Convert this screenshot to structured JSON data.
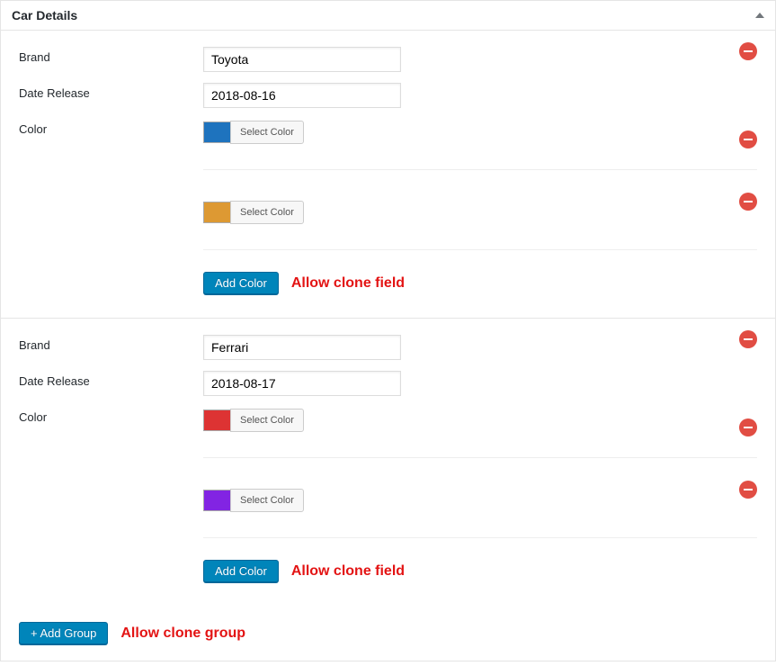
{
  "metabox": {
    "title": "Car Details"
  },
  "labels": {
    "brand": "Brand",
    "date_release": "Date Release",
    "color": "Color",
    "select_color": "Select Color",
    "add_color": "Add Color",
    "add_group": "+ Add Group"
  },
  "annotations": {
    "clone_field": "Allow clone field",
    "clone_group": "Allow clone group"
  },
  "groups": [
    {
      "brand": "Toyota",
      "date_release": "2018-08-16",
      "colors": [
        {
          "hex": "#1e73be"
        },
        {
          "hex": "#dd9933"
        }
      ]
    },
    {
      "brand": "Ferrari",
      "date_release": "2018-08-17",
      "colors": [
        {
          "hex": "#dd3333"
        },
        {
          "hex": "#8224e3"
        }
      ]
    }
  ]
}
